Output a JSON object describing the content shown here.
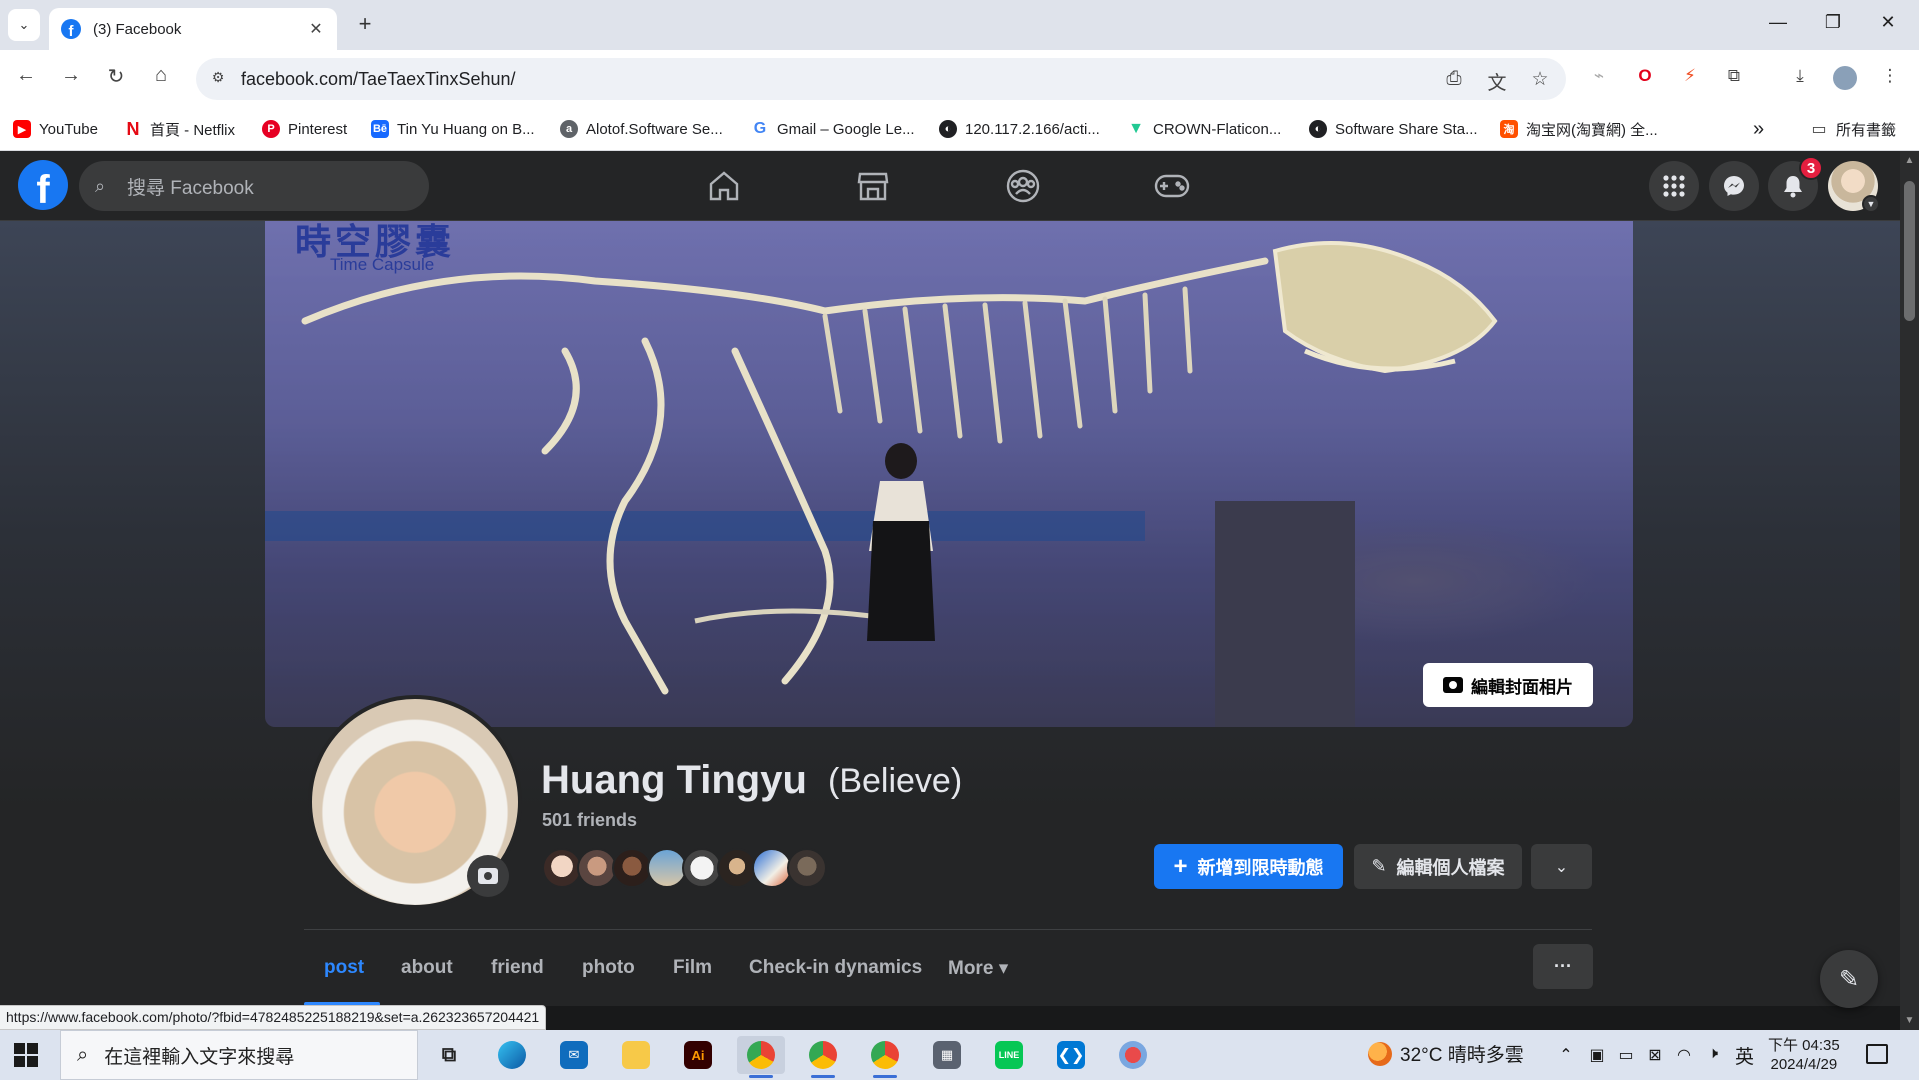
{
  "browser": {
    "tab_title": "(3) Facebook",
    "tab_favicon": "facebook-icon",
    "tab_close": "✕",
    "new_tab": "+",
    "url": "facebook.com/TaeTaexTinxSehun/",
    "status_url": "https://www.facebook.com/photo/?fbid=478248522518821​9&set=a.262323657204421",
    "bookmarks": [
      {
        "label": "YouTube",
        "icon": "youtube-icon",
        "color": "#ff0000"
      },
      {
        "label": "首頁 - Netflix",
        "icon": "netflix-icon",
        "color": "#e50914"
      },
      {
        "label": "Pinterest",
        "icon": "pinterest-icon",
        "color": "#e60023"
      },
      {
        "label": "Tin Yu Huang on B...",
        "icon": "behance-icon",
        "color": "#1769ff"
      },
      {
        "label": "Alotof.Software Se...",
        "icon": "alotof-icon",
        "color": "#5f6368"
      },
      {
        "label": "Gmail – Google Le...",
        "icon": "google-icon",
        "color": "#4285f4"
      },
      {
        "label": "120.117.2.166/acti...",
        "icon": "globe-icon",
        "color": "#202124"
      },
      {
        "label": "CROWN-Flaticon...",
        "icon": "flaticon-icon",
        "color": "#22c993"
      },
      {
        "label": "Software Share Sta...",
        "icon": "globe-icon",
        "color": "#202124"
      },
      {
        "label": "淘宝网(淘寶網) 全...",
        "icon": "taobao-icon",
        "color": "#ff5000"
      }
    ],
    "all_bookmarks": "所有書籤",
    "more_bookmarks": "»"
  },
  "fb": {
    "search_placeholder": "搜尋 Facebook",
    "notification_count": "3",
    "accent": "#1877f2"
  },
  "profile": {
    "name": "Huang Tingyu",
    "alt_name": "(Believe)",
    "friends": "501 friends",
    "edit_cover": "編輯封面相片",
    "add_story": "新增到限時動態",
    "edit_profile": "編輯個人檔案",
    "tabs": [
      "post",
      "about",
      "friend",
      "photo",
      "Film",
      "Check-in dynamics",
      "More"
    ],
    "more_caret": "▾",
    "dots": "···"
  },
  "taskbar": {
    "search_placeholder": "在這裡輸入文字來搜尋",
    "weather": "32°C  晴時多雲",
    "ime": "英",
    "time_period": "下午 04:35",
    "date": "2024/4/29"
  }
}
